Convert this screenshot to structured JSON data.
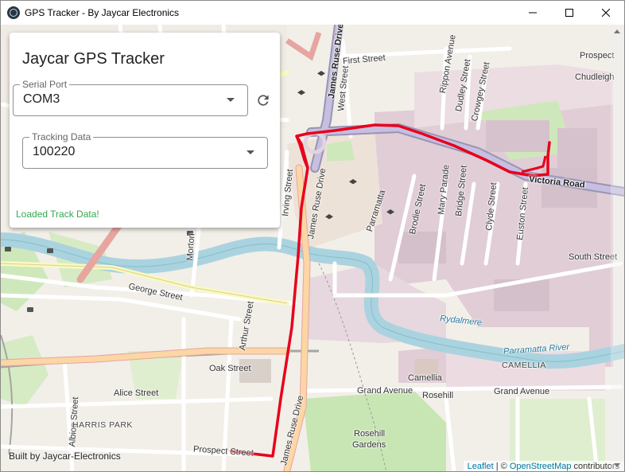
{
  "window": {
    "title": "GPS Tracker - By Jaycar Electronics",
    "icon": "electron-app-icon"
  },
  "panel": {
    "title": "Jaycar GPS Tracker",
    "serial_port": {
      "label": "Serial Port",
      "value": "COM3"
    },
    "tracking_data": {
      "label": "Tracking Data",
      "value": "100220"
    },
    "status": "Loaded Track Data!",
    "status_color": "#34a853"
  },
  "map": {
    "footer_text": "Built by Jaycar-Electronics",
    "attribution": {
      "leaflet": "Leaflet",
      "separator": " | © ",
      "osm": "OpenStreetMap",
      "suffix": " contributors"
    },
    "track_color": "#e8001c",
    "labels": {
      "james_ruse_drive_top": "James Ruse Drive",
      "first_street": "First Street",
      "west_street": "West Street",
      "rippon_avenue": "Rippon Avenue",
      "dudley_street": "Dudley Street",
      "crowgey_street": "Crowgey Street",
      "prospect_top": "Prospect",
      "chudleigh": "Chudleigh",
      "irving_street": "Irving Street",
      "james_ruse_drive_mid": "James Ruse Drive",
      "parramatta": "Parramatta",
      "brodie_street": "Brodie Street",
      "mary_parade": "Mary Parade",
      "bridge_street": "Bridge Street",
      "clyde_street": "Clyde Street",
      "euston_street": "Euston Street",
      "victoria_road": "Victoria Road",
      "morton": "Morton",
      "south_street": "South Street",
      "george_street": "George Street",
      "arthur_street": "Arthur Street",
      "rydalmere": "Rydalmere",
      "parramatta_river": "Parramatta River",
      "oak_street": "Oak Street",
      "camellia": "Camellia",
      "camellia_caps": "CAMELLIA",
      "alice_street": "Alice Street",
      "grand_avenue_1": "Grand Avenue",
      "rosehill": "Rosehill",
      "grand_avenue_2": "Grand Avenue",
      "albion_street": "Albion Street",
      "harris_park": "HARRIS PARK",
      "james_ruse_drive_bottom": "James Ruse Drive",
      "rosehill_gardens_1": "Rosehill",
      "rosehill_gardens_2": "Gardens",
      "prospect_street": "Prospect Street"
    }
  }
}
